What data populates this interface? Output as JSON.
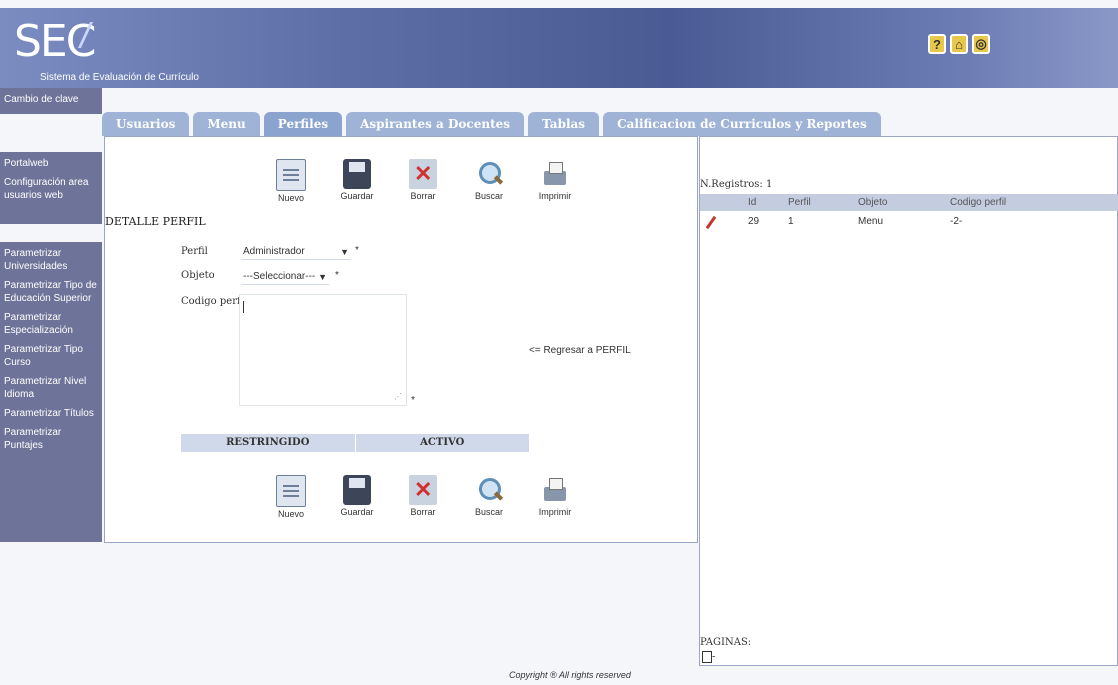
{
  "header": {
    "logo": "SEC",
    "subtitle": "Sistema de Evaluación de Currículo",
    "icons": [
      {
        "name": "help-icon",
        "glyph": "?"
      },
      {
        "name": "home-icon",
        "glyph": "⌂"
      },
      {
        "name": "exit-icon",
        "glyph": "◎"
      }
    ]
  },
  "sidebar": {
    "blocks": [
      [
        "Cambio de clave"
      ],
      [
        "Portalweb",
        "Configuración area usuarios web"
      ],
      [
        "Parametrizar Universidades",
        "Parametrizar Tipo de Educación Superior",
        "Parametrizar Especialización",
        "Parametrizar Tipo Curso",
        "Parametrizar Nivel Idioma",
        "Parametrizar Títulos",
        "Parametrizar Puntajes"
      ]
    ]
  },
  "tabs": [
    "Usuarios",
    "Menu",
    "Perfiles",
    "Aspirantes a Docentes",
    "Tablas",
    "Calificacion de Curriculos y Reportes"
  ],
  "toolbar": {
    "items": [
      {
        "label": "Nuevo",
        "icon": "new-document-icon"
      },
      {
        "label": "Guardar",
        "icon": "save-disk-icon"
      },
      {
        "label": "Borrar",
        "icon": "delete-icon"
      },
      {
        "label": "Buscar",
        "icon": "search-icon"
      },
      {
        "label": "Imprimir",
        "icon": "print-icon"
      }
    ]
  },
  "form": {
    "section_title": "DETALLE PERFIL",
    "perfil_label": "Perfil",
    "perfil_value": "Administrador",
    "objeto_label": "Objeto",
    "objeto_value": "---Seleccionar---",
    "codigo_label": "Codigo perfil",
    "required_mark": "*",
    "back_link": "<= Regresar a PERFIL",
    "status_left": "RESTRINGIDO",
    "status_right": "ACTIVO"
  },
  "results": {
    "count_label": "N.Registros: 1",
    "columns": [
      "",
      "Id",
      "Perfil",
      "Objeto",
      "Codigo perfil"
    ],
    "rows": [
      {
        "id": "29",
        "perfil": "1",
        "objeto": "Menu",
        "codigo": "-2-"
      }
    ],
    "pages_label": "PAGINAS:",
    "page_suffix": "-"
  },
  "footer": "Copyright ® All rights reserved"
}
